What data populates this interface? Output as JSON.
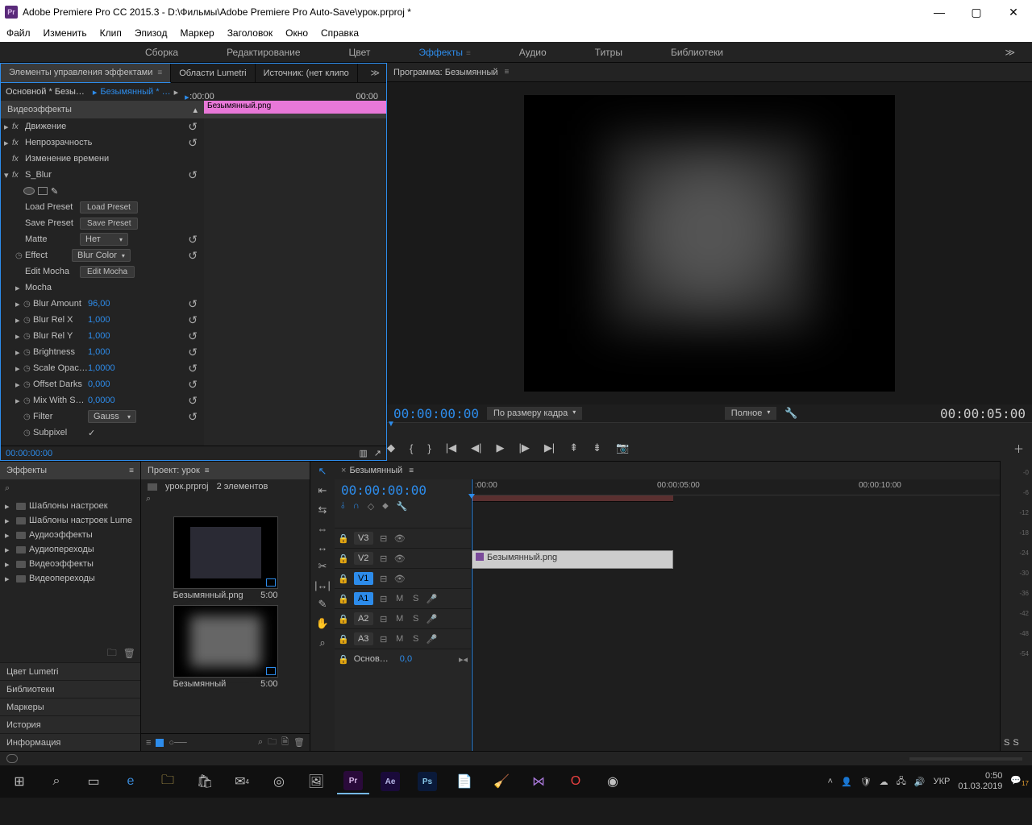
{
  "window": {
    "title": "Adobe Premiere Pro CC 2015.3 - D:\\Фильмы\\Adobe Premiere Pro Auto-Save\\урок.prproj *",
    "logo": "Pr"
  },
  "menu": [
    "Файл",
    "Изменить",
    "Клип",
    "Эпизод",
    "Маркер",
    "Заголовок",
    "Окно",
    "Справка"
  ],
  "workspaces": {
    "items": [
      "Сборка",
      "Редактирование",
      "Цвет",
      "Эффекты",
      "Аудио",
      "Титры",
      "Библиотеки"
    ],
    "active_index": 3
  },
  "effect_controls": {
    "tabs": {
      "controls": "Элементы управления эффектами",
      "lumetri": "Области Lumetri",
      "source": "Источник: (нет клипо"
    },
    "clip_master": "Основной * Безы…",
    "clip_seq": "Безымянный * …",
    "ruler_start": ":00:00",
    "ruler_end": "00:00",
    "header": "Видеоэффекты",
    "pink_clip": "Безымянный.png",
    "rows": {
      "motion": "Движение",
      "opacity": "Непрозрачность",
      "time_remap": "Изменение времени",
      "sblur": "S_Blur",
      "load_preset_l": "Load Preset",
      "load_preset_b": "Load Preset",
      "save_preset_l": "Save Preset",
      "save_preset_b": "Save Preset",
      "matte_l": "Matte",
      "matte_v": "Нет",
      "effect_l": "Effect",
      "effect_v": "Blur Color",
      "edit_mocha_l": "Edit Mocha",
      "edit_mocha_b": "Edit Mocha",
      "mocha": "Mocha",
      "blur_amount_l": "Blur Amount",
      "blur_amount_v": "96,00",
      "blur_relx_l": "Blur Rel X",
      "blur_relx_v": "1,000",
      "blur_rely_l": "Blur Rel Y",
      "blur_rely_v": "1,000",
      "brightness_l": "Brightness",
      "brightness_v": "1,000",
      "scale_l": "Scale Opac…",
      "scale_v": "1,0000",
      "offset_l": "Offset Darks",
      "offset_v": "0,000",
      "mix_l": "Mix With S…",
      "mix_v": "0,0000",
      "filter_l": "Filter",
      "filter_v": "Gauss",
      "subpixel_l": "Subpixel"
    },
    "bottom_tc": "00:00:00:00"
  },
  "program": {
    "tab": "Программа: Безымянный",
    "tc_left": "00:00:00:00",
    "fit": "По размеру кадра",
    "quality": "Полное",
    "tc_right": "00:00:05:00"
  },
  "effects": {
    "title": "Эффекты",
    "folders": [
      "Шаблоны настроек",
      "Шаблоны настроек Lume",
      "Аудиоэффекты",
      "Аудиопереходы",
      "Видеоэффекты",
      "Видеопереходы"
    ],
    "stack": [
      "Цвет Lumetri",
      "Библиотеки",
      "Маркеры",
      "История",
      "Информация"
    ]
  },
  "project": {
    "tab": "Проект: урок",
    "file": "урок.prproj",
    "count": "2 элементов",
    "bin1": {
      "name": "Безымянный.png",
      "dur": "5:00"
    },
    "bin2": {
      "name": "Безымянный",
      "dur": "5:00"
    }
  },
  "timeline": {
    "tab": "Безымянный",
    "tc": "00:00:00:00",
    "ruler": {
      "t0": ":00:00",
      "t1": "00:00:05:00",
      "t2": "00:00:10:00"
    },
    "tracks": {
      "v3": "V3",
      "v2": "V2",
      "v1": "V1",
      "a1": "A1",
      "a2": "A2",
      "a3": "A3",
      "master_l": "Основ…",
      "master_v": "0,0"
    },
    "clip": "Безымянный.png"
  },
  "audiometer": {
    "ticks": [
      "-0",
      "-6",
      "-12",
      "-18",
      "-24",
      "-30",
      "-36",
      "-42",
      "-48",
      "-54"
    ],
    "solo1": "S",
    "solo2": "S"
  },
  "taskbar": {
    "lang": "УКР",
    "time": "0:50",
    "date": "01.03.2019",
    "badge": "17"
  }
}
